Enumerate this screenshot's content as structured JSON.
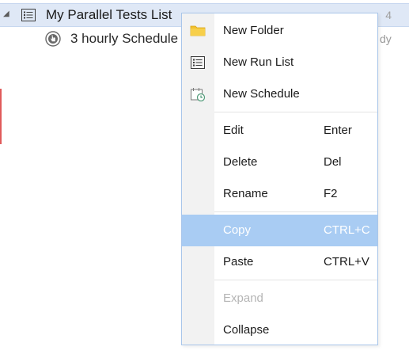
{
  "tree": {
    "row1": {
      "title": "My Parallel Tests List",
      "count": "4",
      "expander": "◢"
    },
    "row2": {
      "title": "3 hourly Schedule",
      "status": "dy"
    }
  },
  "icons": {
    "list": "list-icon",
    "schedule": "schedule-icon",
    "folder": "folder-icon",
    "run_list": "run-list-icon",
    "new_schedule": "calendar-clock-icon"
  },
  "colors": {
    "selected_row": "#dfe8f6",
    "menu_border": "#a9c6ea",
    "menu_highlight": "#a9ccf3",
    "disabled_text": "#b5b5b5",
    "folder": "#f2c12e"
  },
  "menu": {
    "new_folder": "New Folder",
    "new_run_list": "New Run List",
    "new_schedule": "New Schedule",
    "edit": "Edit",
    "edit_shortcut": "Enter",
    "delete": "Delete",
    "delete_shortcut": "Del",
    "rename": "Rename",
    "rename_shortcut": "F2",
    "copy": "Copy",
    "copy_shortcut": "CTRL+C",
    "paste": "Paste",
    "paste_shortcut": "CTRL+V",
    "expand": "Expand",
    "collapse": "Collapse"
  }
}
